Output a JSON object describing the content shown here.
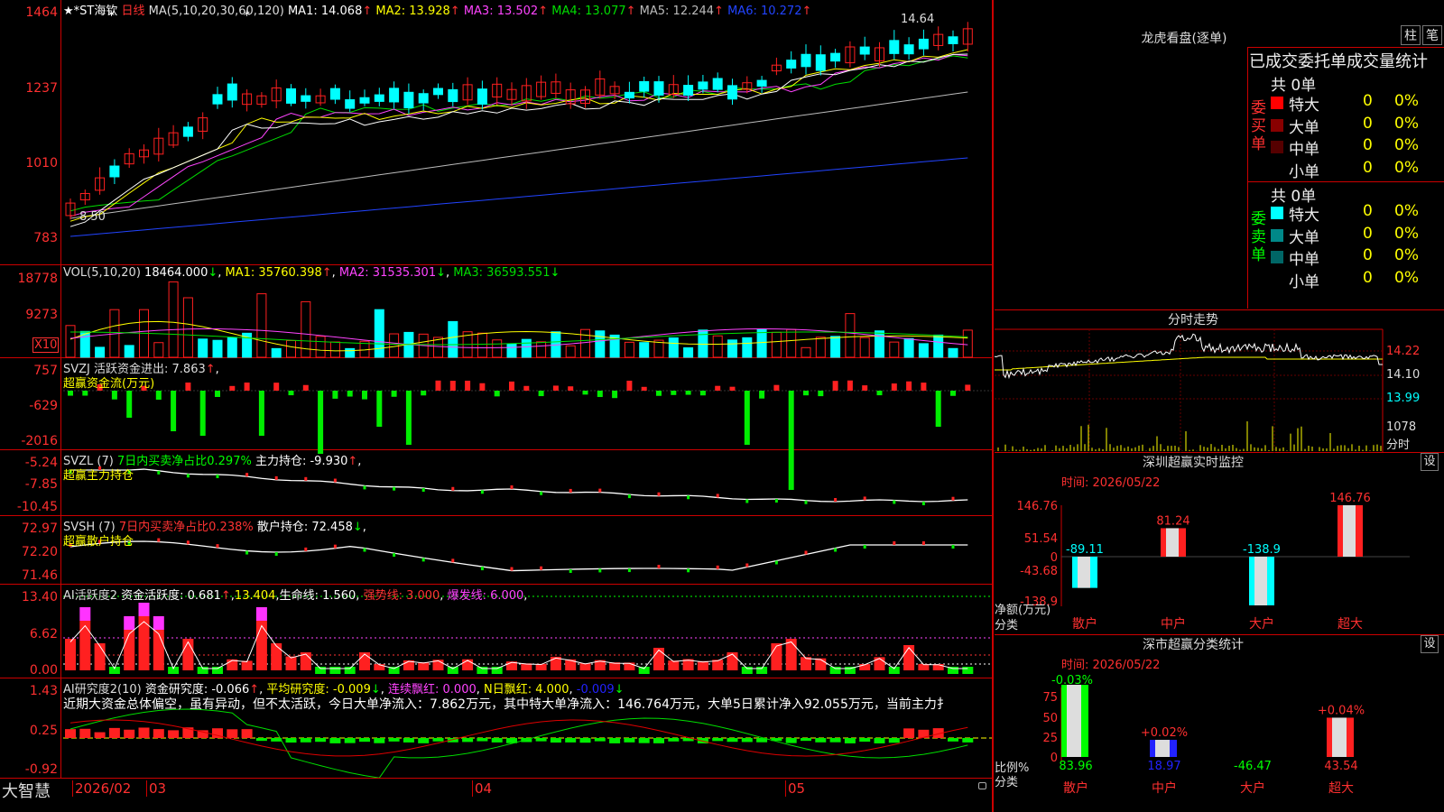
{
  "price_pane": {
    "title": "★*ST海钦",
    "period": "日线",
    "ma_label": "MA(5,10,20,30,60,120)",
    "ma": [
      {
        "name": "MA1",
        "value": "14.068",
        "arrow": "↑",
        "color": "#ffffff"
      },
      {
        "name": "MA2",
        "value": "13.928",
        "arrow": "↑",
        "color": "#ffff00"
      },
      {
        "name": "MA3",
        "value": "13.502",
        "arrow": "↑",
        "color": "#ff44ff"
      },
      {
        "name": "MA4",
        "value": "13.077",
        "arrow": "↑",
        "color": "#00dd00"
      },
      {
        "name": "MA5",
        "value": "12.244",
        "arrow": "↑",
        "color": "#bbbbbb"
      },
      {
        "name": "MA6",
        "value": "10.272",
        "arrow": "↑",
        "color": "#2244ff"
      }
    ],
    "y_ticks": [
      "1464",
      "1237",
      "1010",
      "783"
    ],
    "high_label": "14.64",
    "low_label": "8.50"
  },
  "vol_pane": {
    "label": "VOL(5,10,20)",
    "value": "18464.000",
    "ma1": "MA1: 35760.398",
    "ma2": "MA2: 31535.301",
    "ma3": "MA3: 36593.551",
    "y_ticks": [
      "18778",
      "9273"
    ],
    "unit": "X10"
  },
  "svzj_pane": {
    "line1": "SVZJ  活跃资金进出: 7.863",
    "sub": "超赢资金流(万元)",
    "y_ticks": [
      "757",
      "-629",
      "-2016"
    ]
  },
  "svzl_pane": {
    "name": "SVZL  (7)",
    "desc": "7日内买卖净占比0.297%",
    "main": "主力持仓: -9.930",
    "sub": "超赢主力持仓",
    "y_ticks": [
      "-5.24",
      "-7.85",
      "-10.45"
    ]
  },
  "svsh_pane": {
    "name": "SVSH  (7)",
    "desc": "7日内买卖净占比0.238%",
    "main": "散户持仓: 72.458",
    "sub": "超赢散户持仓",
    "y_ticks": [
      "72.97",
      "72.20",
      "71.46"
    ]
  },
  "ai1_pane": {
    "name": "AI活跃度2",
    "a": "资金活跃度: 0.681",
    "b": "13.404",
    "c": "生命线: 1.560",
    "d": "强势线: 3.000",
    "e": "爆发线: 6.000",
    "y_ticks": [
      "13.40",
      "6.62",
      "0.00"
    ]
  },
  "ai2_pane": {
    "name": "AI研究度2(10)",
    "a": "资金研究度: -0.066",
    "b": "平均研究度: -0.009",
    "c": "连续飘红: 0.000",
    "d": "N日飘红: 4.000",
    "e": "-0.009",
    "text": "近期大资金总体偏空，虽有异动，但不太活跃，今日大单净流入：7.862万元，其中特大单净流入：146.764万元，大单5日累计净入92.055万元，当前主力扌",
    "y_ticks": [
      "1.43",
      "0.25",
      "-0.92"
    ]
  },
  "bottom_bar": {
    "brand": "大智慧",
    "date_start": "2026/02",
    "months": [
      "03",
      "04",
      "05"
    ]
  },
  "longhu": {
    "title": "龙虎看盘(逐单)",
    "btn1": "柱",
    "btn2": "笔",
    "header": "已成交委托单成交量统计",
    "buy": {
      "side": "委买单",
      "total": "共 0单",
      "rows": [
        {
          "label": "特大",
          "val": "0",
          "pct": "0%",
          "color": "#ff0000"
        },
        {
          "label": "大单",
          "val": "0",
          "pct": "0%",
          "color": "#880000"
        },
        {
          "label": "中单",
          "val": "0",
          "pct": "0%",
          "color": "#550000"
        },
        {
          "label": "小单",
          "val": "0",
          "pct": "0%",
          "color": "#000000"
        }
      ]
    },
    "sell": {
      "side": "委卖单",
      "total": "共 0单",
      "rows": [
        {
          "label": "特大",
          "val": "0",
          "pct": "0%",
          "color": "#00ffff"
        },
        {
          "label": "大单",
          "val": "0",
          "pct": "0%",
          "color": "#008888"
        },
        {
          "label": "中单",
          "val": "0",
          "pct": "0%",
          "color": "#006666"
        },
        {
          "label": "小单",
          "val": "0",
          "pct": "0%",
          "color": "#000000"
        }
      ]
    }
  },
  "timeshare": {
    "title": "分时走势",
    "y": [
      "14.22",
      "14.10",
      "13.99",
      "1078"
    ],
    "vol_label": "分时"
  },
  "sz_monitor": {
    "title": "深圳超赢实时监控",
    "set": "设",
    "time": "时间: 2026/05/22",
    "y": [
      "146.76",
      "51.54",
      "0",
      "-43.68",
      "-138.9"
    ],
    "bars": [
      {
        "cat": "散户",
        "value": -89.11,
        "label": "-89.11"
      },
      {
        "cat": "中户",
        "value": 81.24,
        "label": "81.24"
      },
      {
        "cat": "大户",
        "value": -138.9,
        "label": "-138.9"
      },
      {
        "cat": "超大",
        "value": 146.76,
        "label": "146.76"
      }
    ],
    "unit": "净额(万元)",
    "cat_label": "分类"
  },
  "sz_classify": {
    "title": "深市超赢分类统计",
    "set": "设",
    "time": "时间: 2026/05/22",
    "y": [
      "75",
      "50",
      "25",
      "0"
    ],
    "bars": [
      {
        "cat": "散户",
        "pct": 83.96,
        "pct_label": "83.96",
        "chg": "-0.03%"
      },
      {
        "cat": "中户",
        "pct": 18.97,
        "pct_label": "18.97",
        "chg": "+0.02%"
      },
      {
        "cat": "大户",
        "pct": -46.47,
        "pct_label": "-46.47",
        "chg": ""
      },
      {
        "cat": "超大",
        "pct": 43.54,
        "pct_label": "43.54",
        "chg": "+0.04%"
      }
    ],
    "unit": "比例%",
    "cat_label": "分类"
  }
}
